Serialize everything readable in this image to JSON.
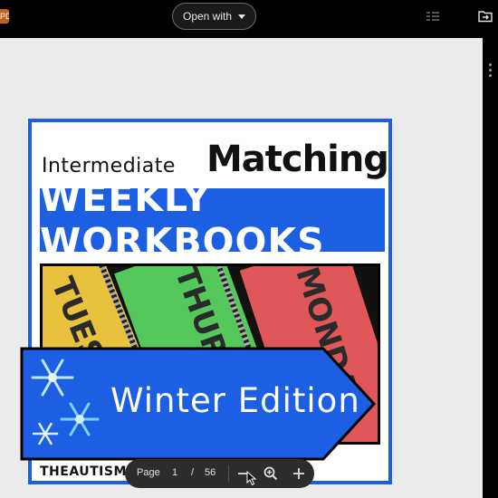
{
  "toolbar": {
    "file_badge": "PDF",
    "open_with_label": "Open with"
  },
  "document": {
    "title_small": "Intermediate",
    "title_big": "Matching",
    "banner": "WEEKLY WORKBOOKS",
    "notebooks": [
      "TUESDAY",
      "THURSDAY",
      "MONDAY"
    ],
    "edition": "Winter Edition",
    "brand": "THEAUTISMHELPER.COM"
  },
  "pager": {
    "label": "Page",
    "current": "1",
    "separator": "/",
    "total": "56"
  },
  "colors": {
    "accent_blue": "#1c5fe3",
    "toolbar_bg": "#000000",
    "viewer_bg": "#ebebeb"
  },
  "icons": [
    "chevron-down-icon",
    "list-icon",
    "move-to-folder-icon",
    "zoom-out-icon",
    "zoom-in-icon",
    "plus-icon",
    "snowflake-icon"
  ]
}
